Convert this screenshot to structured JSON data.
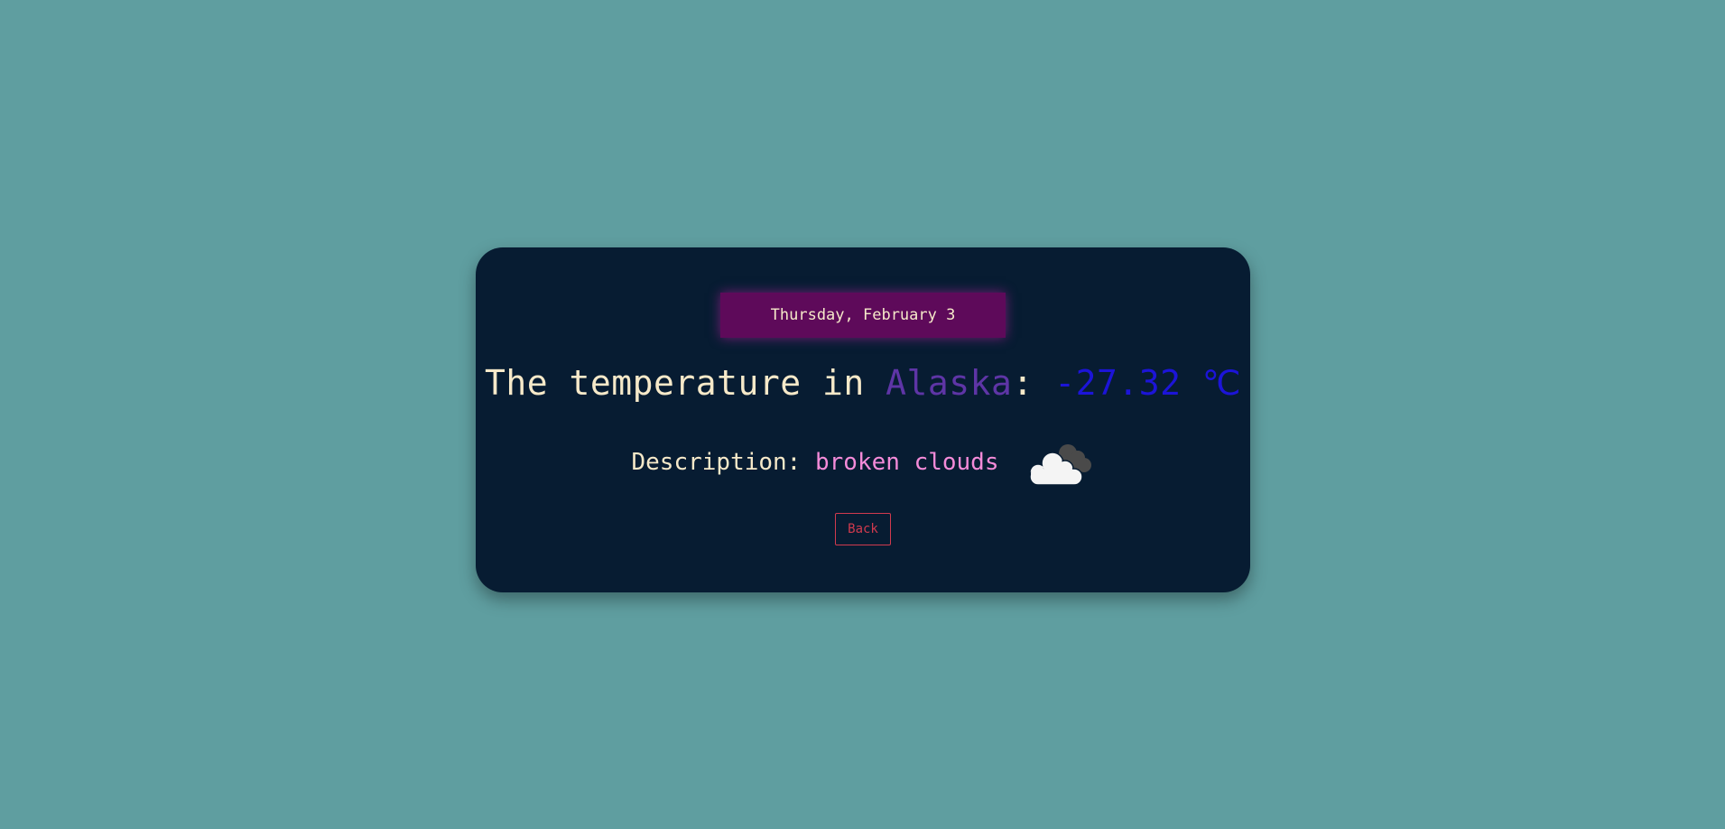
{
  "weather": {
    "date": "Thursday, February 3",
    "temp_prefix": "The temperature in ",
    "city": "Alaska",
    "separator": ": ",
    "temperature": "-27.32 ℃",
    "description_label": "Description: ",
    "description_value": "broken clouds",
    "icon": "broken-clouds-icon",
    "back_label": "Back"
  },
  "colors": {
    "background": "#5f9ea0",
    "card": "#071c32",
    "date_badge": "#5e0a5a",
    "text": "#f6e9c9",
    "city": "#5e35a6",
    "temperature": "#1c14d8",
    "description": "#f48bd9",
    "back_button": "#d13a4e"
  }
}
